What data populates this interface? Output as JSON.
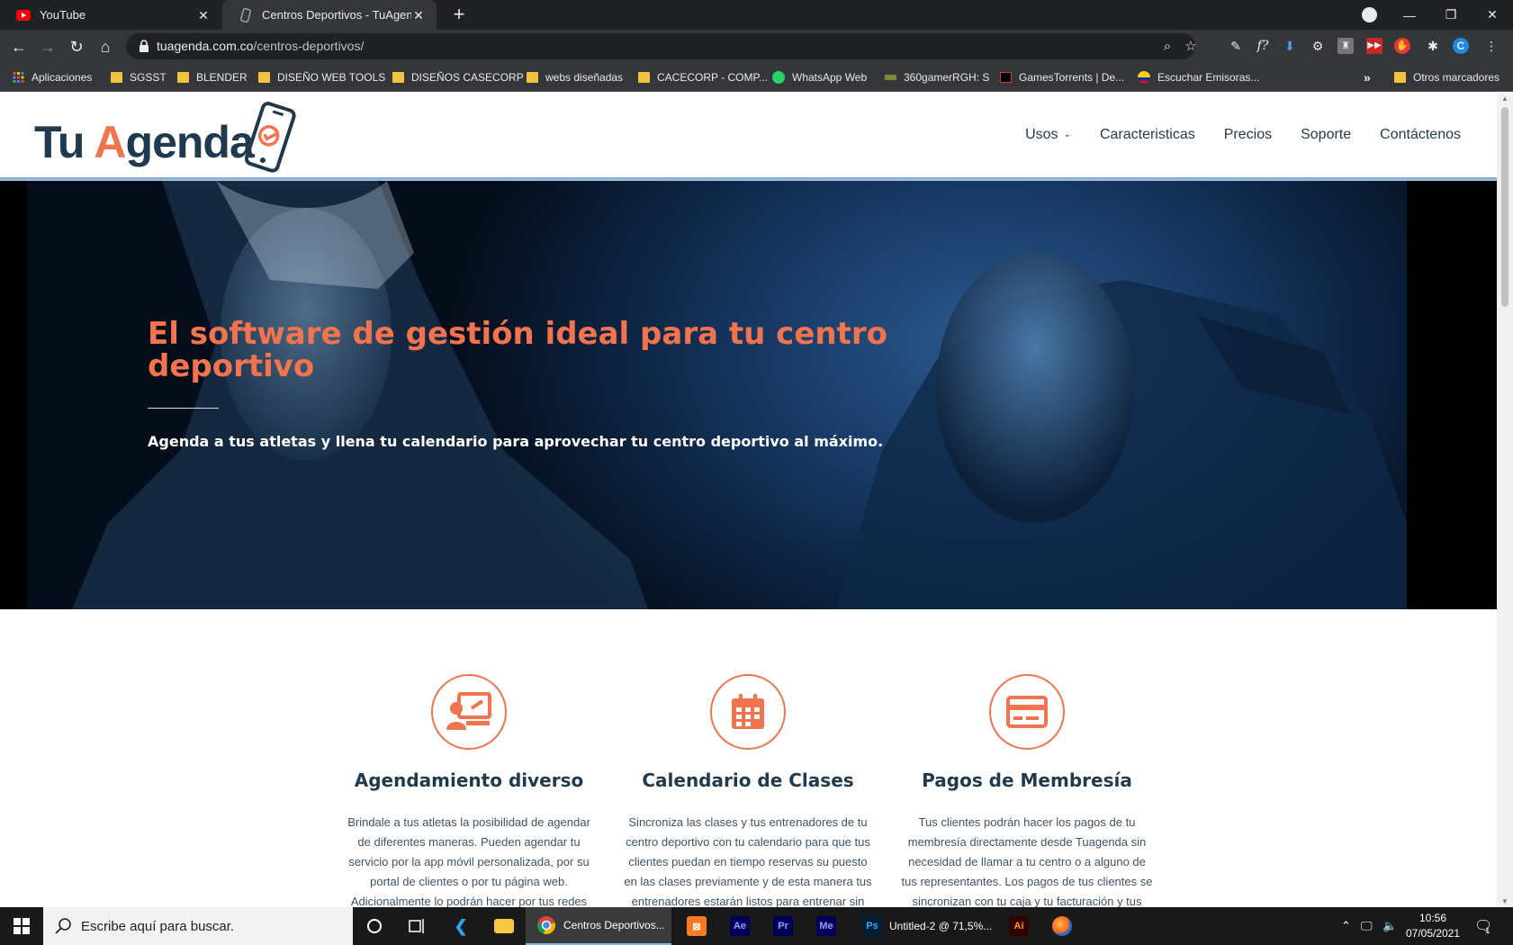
{
  "browser": {
    "tabs": [
      {
        "title": "YouTube",
        "active": false
      },
      {
        "title": "Centros Deportivos - TuAgenda",
        "active": true
      }
    ],
    "url_host": "tuagenda.com.co",
    "url_path": "/centros-deportivos/",
    "bookmarks": [
      {
        "label": "Aplicaciones",
        "icon": "apps-grid-icon"
      },
      {
        "label": "SGSST",
        "icon": "folder-icon"
      },
      {
        "label": "BLENDER",
        "icon": "folder-icon"
      },
      {
        "label": "DISEÑO WEB TOOLS",
        "icon": "folder-icon"
      },
      {
        "label": "DISEÑOS CASECORP",
        "icon": "folder-icon"
      },
      {
        "label": "webs diseñadas",
        "icon": "folder-icon"
      },
      {
        "label": "CACECORP - COMP...",
        "icon": "folder-icon"
      },
      {
        "label": "WhatsApp Web",
        "icon": "whatsapp-icon"
      },
      {
        "label": "360gamerRGH: S",
        "icon": "site-icon"
      },
      {
        "label": "GamesTorrents | De...",
        "icon": "site-icon"
      },
      {
        "label": "Escuchar Emisoras...",
        "icon": "flag-icon"
      }
    ],
    "more_bookmarks": "»",
    "other_bookmarks": "Otros marcadores"
  },
  "site": {
    "logo_part1": "Tu ",
    "logo_a": "A",
    "logo_part2": "genda",
    "nav": [
      {
        "label": "Usos",
        "has_dropdown": true
      },
      {
        "label": "Caracteristicas"
      },
      {
        "label": "Precios"
      },
      {
        "label": "Soporte"
      },
      {
        "label": "Contáctenos"
      }
    ],
    "hero": {
      "title": "El software de gestión ideal para tu centro deportivo",
      "subtitle": "Agenda a tus atletas y llena tu calendario para aprovechar tu centro deportivo al máximo."
    },
    "features": [
      {
        "title": "Agendamiento diverso",
        "icon": "presentation-user-icon",
        "description": "Brindale a tus atletas la posibilidad de agendar de diferentes maneras. Pueden agendar tu servicio por la app móvil personalizada, por su portal de clientes o por tu página web. Adicionalmente lo podrán hacer por tus redes"
      },
      {
        "title": "Calendario de Clases",
        "icon": "calendar-icon",
        "description": "Sincroniza las clases y tus entrenadores de tu centro deportivo con tu calendario para que tus clientes puedan en tiempo reservas su puesto en las clases previamente y de esta manera tus entrenadores estarán listos para entrenar sin"
      },
      {
        "title": "Pagos de Membresía",
        "icon": "credit-card-icon",
        "description": "Tus clientes podrán hacer los pagos de tu membresía directamente desde Tuagenda sin necesidad de llamar a tu centro o a alguno de tus representantes. Los pagos de tus clientes se sincronizan con tu caja y tu facturación y tus"
      }
    ]
  },
  "taskbar": {
    "search_placeholder": "Escribe aquí para buscar.",
    "chrome_label": "Centros Deportivos...",
    "photoshop_label": "Untitled-2 @ 71,5%...",
    "time": "10:56",
    "date": "07/05/2021",
    "notification_count": "1"
  },
  "colors": {
    "accent": "#f2744f",
    "navy": "#1f3a4f"
  }
}
